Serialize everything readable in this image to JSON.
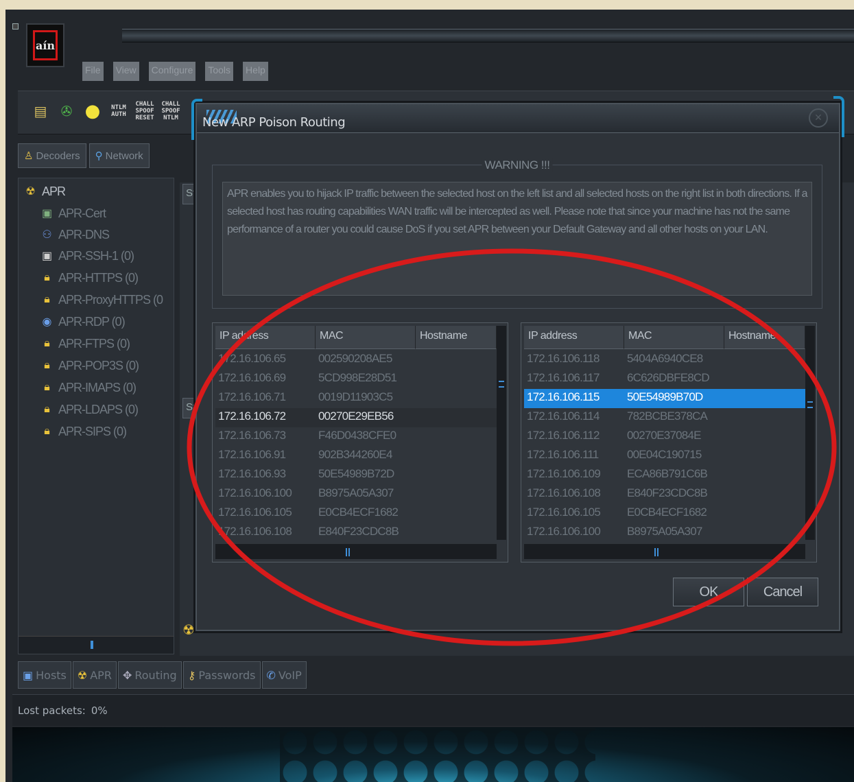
{
  "app": {
    "logo_text": "aín",
    "colors": {
      "accent": "#1e86dc",
      "logo_border": "#d01818",
      "annotation": "#d81b1b"
    }
  },
  "menu": [
    "File",
    "View",
    "Configure",
    "Tools",
    "Help"
  ],
  "toolbar": {
    "ntlm_auth": "NTLM\nAUTH",
    "chall_spoof_reset": "CHALL\nSPOOF\nRESET",
    "chall_spoof_ntlm": "CHALL\nSPOOF\nNTLM"
  },
  "top_tabs": [
    {
      "label": "Decoders",
      "icon": "decoder-icon"
    },
    {
      "label": "Network",
      "icon": "network-icon"
    }
  ],
  "tree": {
    "root": "APR",
    "items": [
      {
        "label": "APR-Cert",
        "icon": "certificate-icon"
      },
      {
        "label": "APR-DNS",
        "icon": "dns-icon"
      },
      {
        "label": "APR-SSH-1 (0)",
        "icon": "terminal-icon"
      },
      {
        "label": "APR-HTTPS (0)",
        "icon": "lock-icon"
      },
      {
        "label": "APR-ProxyHTTPS (0",
        "icon": "lock-icon"
      },
      {
        "label": "APR-RDP (0)",
        "icon": "rdp-icon"
      },
      {
        "label": "APR-FTPS (0)",
        "icon": "lock-icon"
      },
      {
        "label": "APR-POP3S (0)",
        "icon": "lock-icon"
      },
      {
        "label": "APR-IMAPS (0)",
        "icon": "lock-icon"
      },
      {
        "label": "APR-LDAPS (0)",
        "icon": "lock-icon"
      },
      {
        "label": "APR-SIPS (0)",
        "icon": "lock-icon"
      }
    ]
  },
  "right_pane": {
    "header1": "St",
    "header2": "St"
  },
  "bottom_tabs": [
    {
      "label": "Hosts",
      "icon": "hosts-icon"
    },
    {
      "label": "APR",
      "icon": "radiation-icon"
    },
    {
      "label": "Routing",
      "icon": "routing-icon"
    },
    {
      "label": "Passwords",
      "icon": "keys-icon"
    },
    {
      "label": "VoIP",
      "icon": "voip-icon"
    }
  ],
  "status": {
    "lost_packets_label": "Lost packets:",
    "lost_packets_value": "0%"
  },
  "dialog": {
    "title": "New ARP Poison Routing",
    "warning_title": "WARNING !!!",
    "warning_text": "APR enables you to hijack IP traffic between the selected host on the left list and all selected hosts on the right list in both directions. If a selected host has routing capabilities WAN traffic will be intercepted as well. Please note that since your machine has not the same performance of a router you could cause DoS if you set APR between your Default Gateway and all other hosts on your LAN.",
    "columns": [
      "IP address",
      "MAC",
      "Hostname"
    ],
    "left_hosts": [
      {
        "ip": "172.16.106.65",
        "mac": "002590208AE5",
        "host": ""
      },
      {
        "ip": "172.16.106.69",
        "mac": "5CD998E28D51",
        "host": ""
      },
      {
        "ip": "172.16.106.71",
        "mac": "0019D11903C5",
        "host": ""
      },
      {
        "ip": "172.16.106.72",
        "mac": "00270E29EB56",
        "host": "",
        "state": "focused"
      },
      {
        "ip": "172.16.106.73",
        "mac": "F46D0438CFE0",
        "host": ""
      },
      {
        "ip": "172.16.106.91",
        "mac": "902B344260E4",
        "host": ""
      },
      {
        "ip": "172.16.106.93",
        "mac": "50E54989B72D",
        "host": ""
      },
      {
        "ip": "172.16.106.100",
        "mac": "B8975A05A307",
        "host": ""
      },
      {
        "ip": "172.16.106.105",
        "mac": "E0CB4ECF1682",
        "host": ""
      },
      {
        "ip": "172.16.106.108",
        "mac": "E840F23CDC8B",
        "host": ""
      }
    ],
    "right_hosts": [
      {
        "ip": "172.16.106.118",
        "mac": "5404A6940CE8",
        "host": ""
      },
      {
        "ip": "172.16.106.117",
        "mac": "6C626DBFE8CD",
        "host": ""
      },
      {
        "ip": "172.16.106.115",
        "mac": "50E54989B70D",
        "host": "",
        "state": "selected"
      },
      {
        "ip": "172.16.106.114",
        "mac": "782BCBE378CA",
        "host": ""
      },
      {
        "ip": "172.16.106.112",
        "mac": "00270E37084E",
        "host": ""
      },
      {
        "ip": "172.16.106.111",
        "mac": "00E04C190715",
        "host": ""
      },
      {
        "ip": "172.16.106.109",
        "mac": "ECA86B791C6B",
        "host": ""
      },
      {
        "ip": "172.16.106.108",
        "mac": "E840F23CDC8B",
        "host": ""
      },
      {
        "ip": "172.16.106.105",
        "mac": "E0CB4ECF1682",
        "host": ""
      },
      {
        "ip": "172.16.106.100",
        "mac": "B8975A05A307",
        "host": ""
      }
    ],
    "ok_label": "OK",
    "cancel_label": "Cancel"
  }
}
